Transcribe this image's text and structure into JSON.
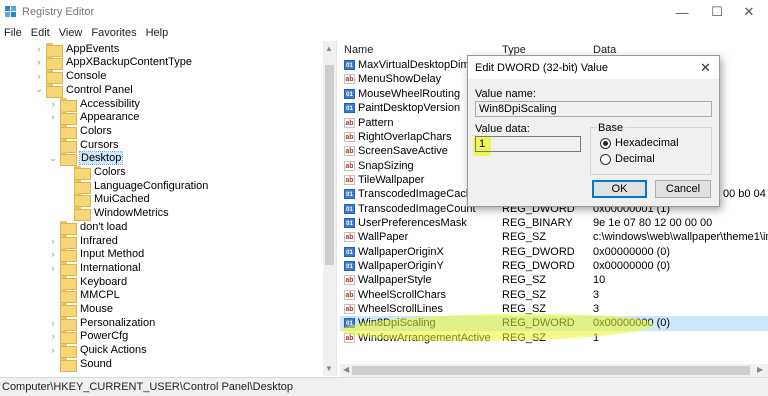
{
  "window": {
    "title": "Registry Editor",
    "min_glyph": "—",
    "max_glyph": "☐",
    "close_glyph": "✕"
  },
  "menu": [
    "File",
    "Edit",
    "View",
    "Favorites",
    "Help"
  ],
  "tree": [
    {
      "label": "AppEvents",
      "arrow": "›"
    },
    {
      "label": "AppXBackupContentType",
      "arrow": "›"
    },
    {
      "label": "Console",
      "arrow": "›"
    },
    {
      "label": "Control Panel",
      "arrow": "⌄"
    },
    {
      "label": "Accessibility",
      "arrow": "›"
    },
    {
      "label": "Appearance",
      "arrow": "›"
    },
    {
      "label": "Colors",
      "arrow": ""
    },
    {
      "label": "Cursors",
      "arrow": ""
    },
    {
      "label": "Desktop",
      "arrow": "⌄",
      "selected": true
    },
    {
      "label": "Colors",
      "arrow": ""
    },
    {
      "label": "LanguageConfiguration",
      "arrow": ""
    },
    {
      "label": "MuiCached",
      "arrow": ""
    },
    {
      "label": "WindowMetrics",
      "arrow": ""
    },
    {
      "label": "don't load",
      "arrow": ""
    },
    {
      "label": "Infrared",
      "arrow": "›"
    },
    {
      "label": "Input Method",
      "arrow": "›"
    },
    {
      "label": "International",
      "arrow": "›"
    },
    {
      "label": "Keyboard",
      "arrow": ""
    },
    {
      "label": "MMCPL",
      "arrow": ""
    },
    {
      "label": "Mouse",
      "arrow": ""
    },
    {
      "label": "Personalization",
      "arrow": "›"
    },
    {
      "label": "PowerCfg",
      "arrow": "›"
    },
    {
      "label": "Quick Actions",
      "arrow": "›"
    },
    {
      "label": "Sound",
      "arrow": ""
    }
  ],
  "list": {
    "headers": {
      "name": "Name",
      "type": "Type",
      "data": "Data"
    },
    "rows": [
      {
        "name": "MaxVirtualDesktopDimension",
        "type": "",
        "data": "",
        "icon": "bin"
      },
      {
        "name": "MenuShowDelay",
        "type": "",
        "data": "",
        "icon": "sz"
      },
      {
        "name": "MouseWheelRouting",
        "type": "",
        "data": "",
        "icon": "bin"
      },
      {
        "name": "PaintDesktopVersion",
        "type": "",
        "data": "",
        "icon": "bin"
      },
      {
        "name": "Pattern",
        "type": "",
        "data": "",
        "icon": "sz"
      },
      {
        "name": "RightOverlapChars",
        "type": "",
        "data": "",
        "icon": "sz"
      },
      {
        "name": "ScreenSaveActive",
        "type": "",
        "data": "",
        "icon": "sz"
      },
      {
        "name": "SnapSizing",
        "type": "",
        "data": "",
        "icon": "sz"
      },
      {
        "name": "TileWallpaper",
        "type": "",
        "data": "",
        "icon": "sz"
      },
      {
        "name": "TranscodedImageCache",
        "type": "",
        "data": "00 b0 04",
        "icon": "bin"
      },
      {
        "name": "TranscodedImageCount",
        "type": "REG_DWORD",
        "data": "0x00000001 (1)",
        "icon": "bin"
      },
      {
        "name": "UserPreferencesMask",
        "type": "REG_BINARY",
        "data": "9e 1e 07 80 12 00 00 00",
        "icon": "bin"
      },
      {
        "name": "WallPaper",
        "type": "REG_SZ",
        "data": "c:\\windows\\web\\wallpaper\\theme1\\im",
        "icon": "sz"
      },
      {
        "name": "WallpaperOriginX",
        "type": "REG_DWORD",
        "data": "0x00000000 (0)",
        "icon": "bin"
      },
      {
        "name": "WallpaperOriginY",
        "type": "REG_DWORD",
        "data": "0x00000000 (0)",
        "icon": "bin"
      },
      {
        "name": "WallpaperStyle",
        "type": "REG_SZ",
        "data": "10",
        "icon": "sz"
      },
      {
        "name": "WheelScrollChars",
        "type": "REG_SZ",
        "data": "3",
        "icon": "sz"
      },
      {
        "name": "WheelScrollLines",
        "type": "REG_SZ",
        "data": "3",
        "icon": "sz"
      },
      {
        "name": "Win8DpiScaling",
        "type": "REG_DWORD",
        "data": "0x00000000 (0)",
        "icon": "bin",
        "selected": true
      },
      {
        "name": "WindowArrangementActive",
        "type": "REG_SZ",
        "data": "1",
        "icon": "sz"
      }
    ]
  },
  "status": "Computer\\HKEY_CURRENT_USER\\Control Panel\\Desktop",
  "dialog": {
    "title": "Edit DWORD (32-bit) Value",
    "close_glyph": "✕",
    "value_name_label": "Value name:",
    "value_name": "Win8DpiScaling",
    "value_data_label": "Value data:",
    "value_data": "1",
    "base_label": "Base",
    "hex_label": "Hexadecimal",
    "dec_label": "Decimal",
    "base_selected": "Hexadecimal",
    "ok_label": "OK",
    "cancel_label": "Cancel"
  },
  "colors": {
    "selection": "#cce8ff",
    "highlighter": "#ebf528",
    "accent": "#0078d7"
  },
  "icons": {
    "app": "registry-editor-icon",
    "tree_folder": "folder-icon",
    "string_value": "string-value-icon",
    "binary_value": "binary-value-icon"
  }
}
